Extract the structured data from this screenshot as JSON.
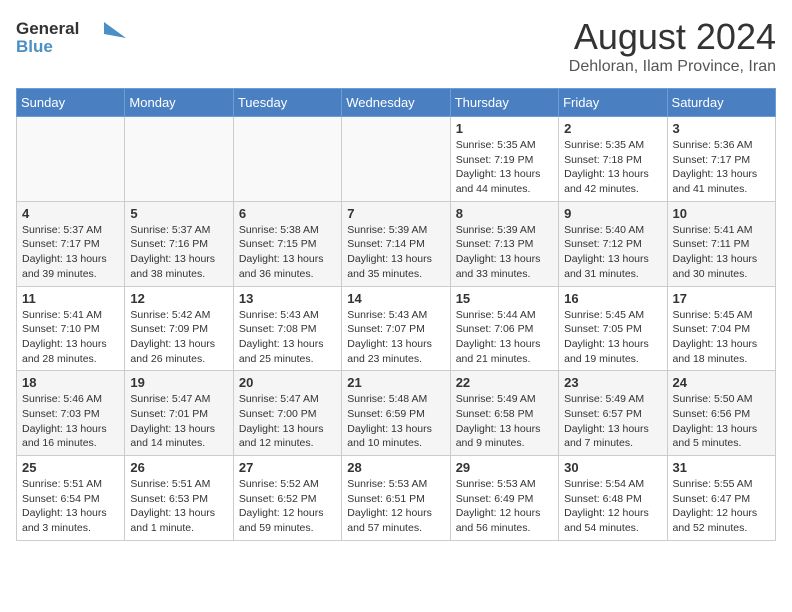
{
  "header": {
    "logo_line1": "General",
    "logo_line2": "Blue",
    "month_year": "August 2024",
    "subtitle": "Dehloran, Ilam Province, Iran"
  },
  "days_of_week": [
    "Sunday",
    "Monday",
    "Tuesday",
    "Wednesday",
    "Thursday",
    "Friday",
    "Saturday"
  ],
  "weeks": [
    [
      {
        "day": "",
        "info": ""
      },
      {
        "day": "",
        "info": ""
      },
      {
        "day": "",
        "info": ""
      },
      {
        "day": "",
        "info": ""
      },
      {
        "day": "1",
        "info": "Sunrise: 5:35 AM\nSunset: 7:19 PM\nDaylight: 13 hours\nand 44 minutes."
      },
      {
        "day": "2",
        "info": "Sunrise: 5:35 AM\nSunset: 7:18 PM\nDaylight: 13 hours\nand 42 minutes."
      },
      {
        "day": "3",
        "info": "Sunrise: 5:36 AM\nSunset: 7:17 PM\nDaylight: 13 hours\nand 41 minutes."
      }
    ],
    [
      {
        "day": "4",
        "info": "Sunrise: 5:37 AM\nSunset: 7:17 PM\nDaylight: 13 hours\nand 39 minutes."
      },
      {
        "day": "5",
        "info": "Sunrise: 5:37 AM\nSunset: 7:16 PM\nDaylight: 13 hours\nand 38 minutes."
      },
      {
        "day": "6",
        "info": "Sunrise: 5:38 AM\nSunset: 7:15 PM\nDaylight: 13 hours\nand 36 minutes."
      },
      {
        "day": "7",
        "info": "Sunrise: 5:39 AM\nSunset: 7:14 PM\nDaylight: 13 hours\nand 35 minutes."
      },
      {
        "day": "8",
        "info": "Sunrise: 5:39 AM\nSunset: 7:13 PM\nDaylight: 13 hours\nand 33 minutes."
      },
      {
        "day": "9",
        "info": "Sunrise: 5:40 AM\nSunset: 7:12 PM\nDaylight: 13 hours\nand 31 minutes."
      },
      {
        "day": "10",
        "info": "Sunrise: 5:41 AM\nSunset: 7:11 PM\nDaylight: 13 hours\nand 30 minutes."
      }
    ],
    [
      {
        "day": "11",
        "info": "Sunrise: 5:41 AM\nSunset: 7:10 PM\nDaylight: 13 hours\nand 28 minutes."
      },
      {
        "day": "12",
        "info": "Sunrise: 5:42 AM\nSunset: 7:09 PM\nDaylight: 13 hours\nand 26 minutes."
      },
      {
        "day": "13",
        "info": "Sunrise: 5:43 AM\nSunset: 7:08 PM\nDaylight: 13 hours\nand 25 minutes."
      },
      {
        "day": "14",
        "info": "Sunrise: 5:43 AM\nSunset: 7:07 PM\nDaylight: 13 hours\nand 23 minutes."
      },
      {
        "day": "15",
        "info": "Sunrise: 5:44 AM\nSunset: 7:06 PM\nDaylight: 13 hours\nand 21 minutes."
      },
      {
        "day": "16",
        "info": "Sunrise: 5:45 AM\nSunset: 7:05 PM\nDaylight: 13 hours\nand 19 minutes."
      },
      {
        "day": "17",
        "info": "Sunrise: 5:45 AM\nSunset: 7:04 PM\nDaylight: 13 hours\nand 18 minutes."
      }
    ],
    [
      {
        "day": "18",
        "info": "Sunrise: 5:46 AM\nSunset: 7:03 PM\nDaylight: 13 hours\nand 16 minutes."
      },
      {
        "day": "19",
        "info": "Sunrise: 5:47 AM\nSunset: 7:01 PM\nDaylight: 13 hours\nand 14 minutes."
      },
      {
        "day": "20",
        "info": "Sunrise: 5:47 AM\nSunset: 7:00 PM\nDaylight: 13 hours\nand 12 minutes."
      },
      {
        "day": "21",
        "info": "Sunrise: 5:48 AM\nSunset: 6:59 PM\nDaylight: 13 hours\nand 10 minutes."
      },
      {
        "day": "22",
        "info": "Sunrise: 5:49 AM\nSunset: 6:58 PM\nDaylight: 13 hours\nand 9 minutes."
      },
      {
        "day": "23",
        "info": "Sunrise: 5:49 AM\nSunset: 6:57 PM\nDaylight: 13 hours\nand 7 minutes."
      },
      {
        "day": "24",
        "info": "Sunrise: 5:50 AM\nSunset: 6:56 PM\nDaylight: 13 hours\nand 5 minutes."
      }
    ],
    [
      {
        "day": "25",
        "info": "Sunrise: 5:51 AM\nSunset: 6:54 PM\nDaylight: 13 hours\nand 3 minutes."
      },
      {
        "day": "26",
        "info": "Sunrise: 5:51 AM\nSunset: 6:53 PM\nDaylight: 13 hours\nand 1 minute."
      },
      {
        "day": "27",
        "info": "Sunrise: 5:52 AM\nSunset: 6:52 PM\nDaylight: 12 hours\nand 59 minutes."
      },
      {
        "day": "28",
        "info": "Sunrise: 5:53 AM\nSunset: 6:51 PM\nDaylight: 12 hours\nand 57 minutes."
      },
      {
        "day": "29",
        "info": "Sunrise: 5:53 AM\nSunset: 6:49 PM\nDaylight: 12 hours\nand 56 minutes."
      },
      {
        "day": "30",
        "info": "Sunrise: 5:54 AM\nSunset: 6:48 PM\nDaylight: 12 hours\nand 54 minutes."
      },
      {
        "day": "31",
        "info": "Sunrise: 5:55 AM\nSunset: 6:47 PM\nDaylight: 12 hours\nand 52 minutes."
      }
    ]
  ]
}
